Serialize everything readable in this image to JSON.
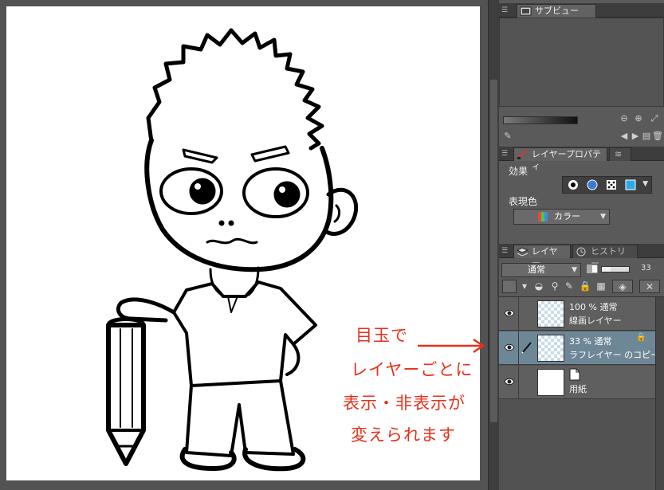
{
  "panels": {
    "subview": {
      "tab_label": "サブビュー"
    },
    "layer_property": {
      "tab_label": "レイヤープロパティ",
      "effect_label": "効果",
      "expression_color_label": "表現色",
      "expression_color_value": "カラー"
    },
    "layer": {
      "tab_label": "レイヤー",
      "history_tab_label": "ヒストリー",
      "blend_mode": "通常",
      "opacity": "33",
      "opacity_fraction": 0.33,
      "layers": [
        {
          "line1": "100 % 通常",
          "line2": "線画レイヤー",
          "selected": false,
          "visible": true
        },
        {
          "line1": "33 % 通常",
          "line2": "ラフレイヤー のコピー",
          "selected": true,
          "visible": true
        },
        {
          "line1": "",
          "line2": "用紙",
          "selected": false,
          "visible": true
        }
      ]
    }
  },
  "annotation": {
    "lines": [
      "目玉で",
      "レイヤーごとに",
      "表示・非表示が",
      "変えられます"
    ],
    "color": "#e8301a"
  },
  "colors": {
    "accent_selected": "#6d8797",
    "panel_bg": "#5a5a5a",
    "annotation": "#e8301a"
  }
}
